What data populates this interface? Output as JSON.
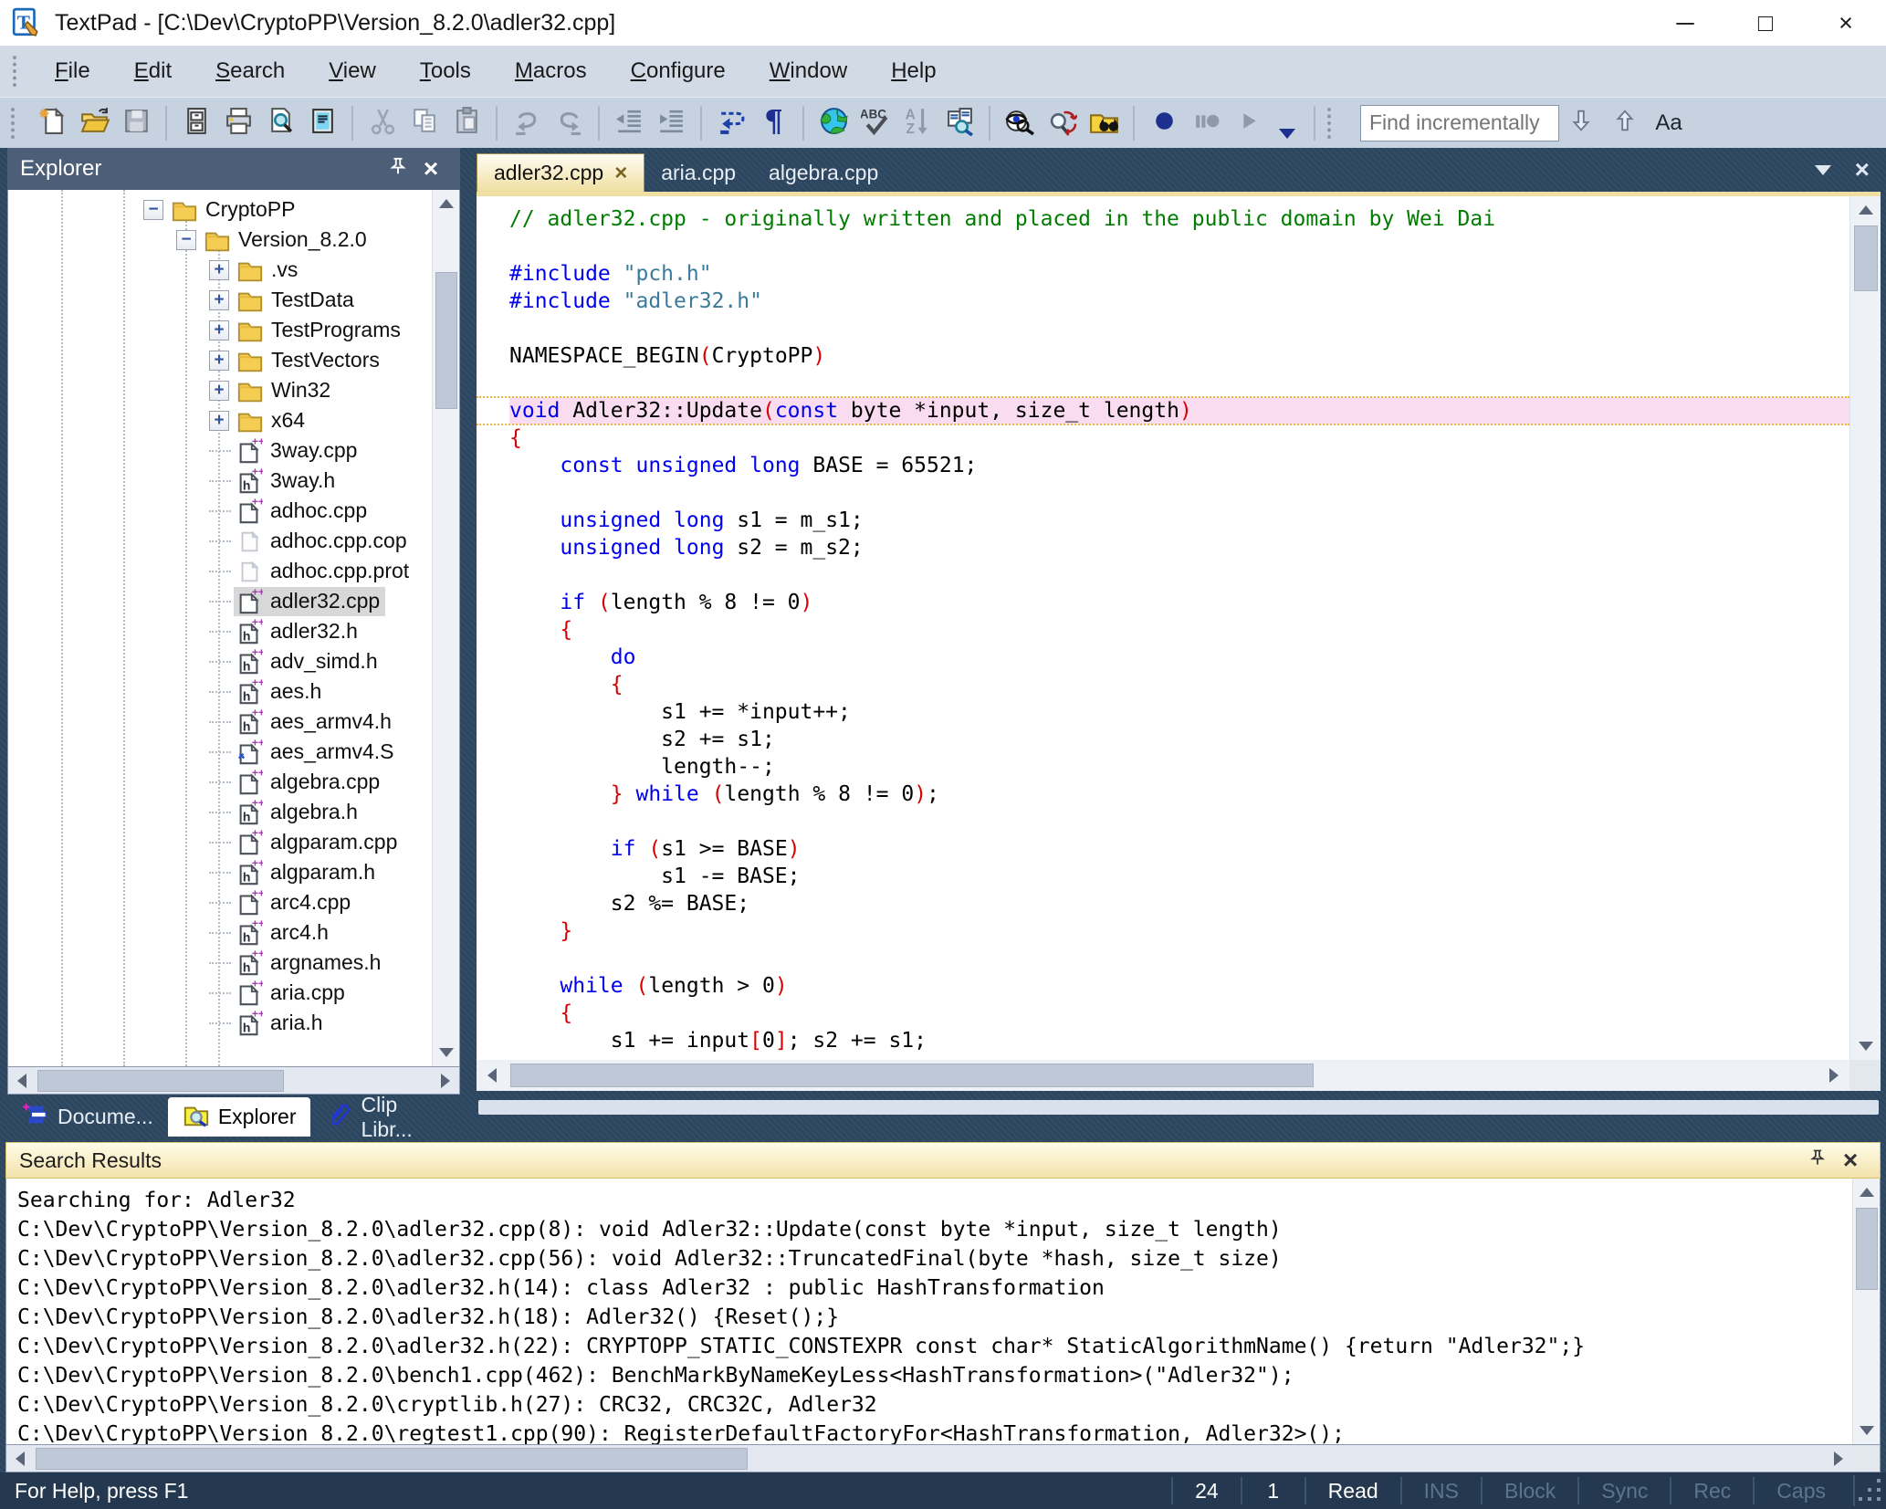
{
  "titlebar": {
    "title": "TextPad - [C:\\Dev\\CryptoPP\\Version_8.2.0\\adler32.cpp]",
    "minimize": "─",
    "maximize": "□",
    "close": "×"
  },
  "menubar": {
    "items": [
      [
        "File",
        0
      ],
      [
        "Edit",
        0
      ],
      [
        "Search",
        0
      ],
      [
        "View",
        0
      ],
      [
        "Tools",
        0
      ],
      [
        "Macros",
        0
      ],
      [
        "Configure",
        0
      ],
      [
        "Window",
        0
      ],
      [
        "Help",
        0
      ]
    ]
  },
  "toolbar": {
    "groups": [
      [
        {
          "icon": "new-document"
        },
        {
          "icon": "open-file"
        },
        {
          "icon": "save",
          "disabled": true
        }
      ],
      [
        {
          "icon": "file-cabinet"
        },
        {
          "icon": "print"
        },
        {
          "icon": "print-preview"
        },
        {
          "icon": "document-properties"
        }
      ],
      [
        {
          "icon": "cut",
          "disabled": true
        },
        {
          "icon": "copy",
          "disabled": true
        },
        {
          "icon": "paste",
          "disabled": true
        }
      ],
      [
        {
          "icon": "undo",
          "disabled": true
        },
        {
          "icon": "redo",
          "disabled": true
        }
      ],
      [
        {
          "icon": "unindent"
        },
        {
          "icon": "indent"
        }
      ],
      [
        {
          "icon": "word-wrap"
        },
        {
          "icon": "show-formatting"
        }
      ],
      [
        {
          "icon": "web-browse"
        },
        {
          "icon": "spell-check"
        },
        {
          "icon": "sort",
          "disabled": true
        },
        {
          "icon": "compare-files"
        }
      ],
      [
        {
          "icon": "document-view"
        },
        {
          "icon": "search-replace"
        },
        {
          "icon": "find-in-files"
        }
      ],
      [
        {
          "icon": "record-macro"
        },
        {
          "icon": "pause-macro",
          "disabled": true
        },
        {
          "icon": "play-macro",
          "disabled": true
        }
      ]
    ],
    "find": {
      "placeholder": "Find incrementally",
      "match_case": "Aa"
    }
  },
  "explorer": {
    "title": "Explorer",
    "tree": [
      {
        "label": "CryptoPP",
        "icon": "folder",
        "expander": "minus",
        "level": 0
      },
      {
        "label": "Version_8.2.0",
        "icon": "folder",
        "expander": "minus",
        "level": 1
      },
      {
        "label": ".vs",
        "icon": "folder",
        "expander": "plus",
        "level": 2
      },
      {
        "label": "TestData",
        "icon": "folder",
        "expander": "plus",
        "level": 2
      },
      {
        "label": "TestPrograms",
        "icon": "folder",
        "expander": "plus",
        "level": 2
      },
      {
        "label": "TestVectors",
        "icon": "folder",
        "expander": "plus",
        "level": 2
      },
      {
        "label": "Win32",
        "icon": "folder",
        "expander": "plus",
        "level": 2
      },
      {
        "label": "x64",
        "icon": "folder",
        "expander": "plus",
        "level": 2
      },
      {
        "label": "3way.cpp",
        "icon": "doc-cpp",
        "level": 2
      },
      {
        "label": "3way.h",
        "icon": "doc-h",
        "level": 2
      },
      {
        "label": "adhoc.cpp",
        "icon": "doc-cpp",
        "level": 2
      },
      {
        "label": "adhoc.cpp.cop",
        "icon": "doc-plain",
        "level": 2
      },
      {
        "label": "adhoc.cpp.prot",
        "icon": "doc-plain",
        "level": 2
      },
      {
        "label": "adler32.cpp",
        "icon": "doc-cpp",
        "level": 2,
        "selected": true
      },
      {
        "label": "adler32.h",
        "icon": "doc-h",
        "level": 2
      },
      {
        "label": "adv_simd.h",
        "icon": "doc-h",
        "level": 2
      },
      {
        "label": "aes.h",
        "icon": "doc-h",
        "level": 2
      },
      {
        "label": "aes_armv4.h",
        "icon": "doc-h",
        "level": 2
      },
      {
        "label": "aes_armv4.S",
        "icon": "doc-asm",
        "level": 2
      },
      {
        "label": "algebra.cpp",
        "icon": "doc-cpp",
        "level": 2
      },
      {
        "label": "algebra.h",
        "icon": "doc-h",
        "level": 2
      },
      {
        "label": "algparam.cpp",
        "icon": "doc-cpp",
        "level": 2
      },
      {
        "label": "algparam.h",
        "icon": "doc-h",
        "level": 2
      },
      {
        "label": "arc4.cpp",
        "icon": "doc-cpp",
        "level": 2
      },
      {
        "label": "arc4.h",
        "icon": "doc-h",
        "level": 2
      },
      {
        "label": "argnames.h",
        "icon": "doc-h",
        "level": 2
      },
      {
        "label": "aria.cpp",
        "icon": "doc-cpp",
        "level": 2
      },
      {
        "label": "aria.h",
        "icon": "doc-h",
        "level": 2
      }
    ]
  },
  "tabs": {
    "documents": [
      {
        "label": "adler32.cpp",
        "active": true,
        "close": "×"
      },
      {
        "label": "aria.cpp"
      },
      {
        "label": "algebra.cpp"
      }
    ]
  },
  "editor": {
    "lines": [
      {
        "t": [
          [
            "c",
            "// adler32.cpp - originally written and placed in the public domain by Wei Dai"
          ]
        ]
      },
      {
        "t": []
      },
      {
        "t": [
          [
            "k",
            "#include"
          ],
          [
            "n",
            " "
          ],
          [
            "s",
            "\"pch.h\""
          ]
        ]
      },
      {
        "t": [
          [
            "k",
            "#include"
          ],
          [
            "n",
            " "
          ],
          [
            "s",
            "\"adler32.h\""
          ]
        ]
      },
      {
        "t": []
      },
      {
        "t": [
          [
            "n",
            "NAMESPACE_BEGIN"
          ],
          [
            "p",
            "("
          ],
          [
            "n",
            "CryptoPP"
          ],
          [
            "p",
            ")"
          ]
        ]
      },
      {
        "t": []
      },
      {
        "hl": true,
        "t": [
          [
            "k",
            "void"
          ],
          [
            "n",
            " Adler32::Update"
          ],
          [
            "p",
            "("
          ],
          [
            "k",
            "const"
          ],
          [
            "n",
            " byte *input, size_t length"
          ],
          [
            "p",
            ")"
          ]
        ]
      },
      {
        "t": [
          [
            "p",
            "{"
          ]
        ]
      },
      {
        "t": [
          [
            "n",
            "    "
          ],
          [
            "k",
            "const"
          ],
          [
            "n",
            " "
          ],
          [
            "k",
            "unsigned"
          ],
          [
            "n",
            " "
          ],
          [
            "k",
            "long"
          ],
          [
            "n",
            " BASE = 65521;"
          ]
        ]
      },
      {
        "t": []
      },
      {
        "t": [
          [
            "n",
            "    "
          ],
          [
            "k",
            "unsigned"
          ],
          [
            "n",
            " "
          ],
          [
            "k",
            "long"
          ],
          [
            "n",
            " s1 = m_s1;"
          ]
        ]
      },
      {
        "t": [
          [
            "n",
            "    "
          ],
          [
            "k",
            "unsigned"
          ],
          [
            "n",
            " "
          ],
          [
            "k",
            "long"
          ],
          [
            "n",
            " s2 = m_s2;"
          ]
        ]
      },
      {
        "t": []
      },
      {
        "t": [
          [
            "n",
            "    "
          ],
          [
            "k",
            "if"
          ],
          [
            "n",
            " "
          ],
          [
            "p",
            "("
          ],
          [
            "n",
            "length % 8 != 0"
          ],
          [
            "p",
            ")"
          ]
        ]
      },
      {
        "t": [
          [
            "n",
            "    "
          ],
          [
            "p",
            "{"
          ]
        ]
      },
      {
        "t": [
          [
            "n",
            "        "
          ],
          [
            "k",
            "do"
          ]
        ]
      },
      {
        "t": [
          [
            "n",
            "        "
          ],
          [
            "p",
            "{"
          ]
        ]
      },
      {
        "t": [
          [
            "n",
            "            s1 += *input++;"
          ]
        ]
      },
      {
        "t": [
          [
            "n",
            "            s2 += s1;"
          ]
        ]
      },
      {
        "t": [
          [
            "n",
            "            length--;"
          ]
        ]
      },
      {
        "t": [
          [
            "n",
            "        "
          ],
          [
            "p",
            "}"
          ],
          [
            "n",
            " "
          ],
          [
            "k",
            "while"
          ],
          [
            "n",
            " "
          ],
          [
            "p",
            "("
          ],
          [
            "n",
            "length % 8 != 0"
          ],
          [
            "p",
            ")"
          ],
          [
            "n",
            ";"
          ]
        ]
      },
      {
        "t": []
      },
      {
        "t": [
          [
            "n",
            "        "
          ],
          [
            "k",
            "if"
          ],
          [
            "n",
            " "
          ],
          [
            "p",
            "("
          ],
          [
            "n",
            "s1 >= BASE"
          ],
          [
            "p",
            ")"
          ]
        ]
      },
      {
        "t": [
          [
            "n",
            "            s1 -= BASE;"
          ]
        ]
      },
      {
        "t": [
          [
            "n",
            "        s2 %= BASE;"
          ]
        ]
      },
      {
        "t": [
          [
            "n",
            "    "
          ],
          [
            "p",
            "}"
          ]
        ]
      },
      {
        "t": []
      },
      {
        "t": [
          [
            "n",
            "    "
          ],
          [
            "k",
            "while"
          ],
          [
            "n",
            " "
          ],
          [
            "p",
            "("
          ],
          [
            "n",
            "length > 0"
          ],
          [
            "p",
            ")"
          ]
        ]
      },
      {
        "t": [
          [
            "n",
            "    "
          ],
          [
            "p",
            "{"
          ]
        ]
      },
      {
        "t": [
          [
            "n",
            "        s1 += input"
          ],
          [
            "p",
            "["
          ],
          [
            "n",
            "0"
          ],
          [
            "p",
            "]"
          ],
          [
            "n",
            "; s2 += s1;"
          ]
        ]
      }
    ]
  },
  "panel_tabs": [
    {
      "label": "Docume...",
      "icon": "documents-stack"
    },
    {
      "label": "Explorer",
      "icon": "folder-search",
      "active": true
    },
    {
      "label": "Clip Libr...",
      "icon": "paperclip"
    }
  ],
  "search_results": {
    "title": "Search Results",
    "lines": [
      "Searching for: Adler32",
      "C:\\Dev\\CryptoPP\\Version_8.2.0\\adler32.cpp(8): void Adler32::Update(const byte *input, size_t length)",
      "C:\\Dev\\CryptoPP\\Version_8.2.0\\adler32.cpp(56): void Adler32::TruncatedFinal(byte *hash, size_t size)",
      "C:\\Dev\\CryptoPP\\Version_8.2.0\\adler32.h(14): class Adler32 : public HashTransformation",
      "C:\\Dev\\CryptoPP\\Version_8.2.0\\adler32.h(18): Adler32() {Reset();}",
      "C:\\Dev\\CryptoPP\\Version_8.2.0\\adler32.h(22): CRYPTOPP_STATIC_CONSTEXPR const char* StaticAlgorithmName() {return \"Adler32\";}",
      "C:\\Dev\\CryptoPP\\Version_8.2.0\\bench1.cpp(462): BenchMarkByNameKeyLess<HashTransformation>(\"Adler32\");",
      "C:\\Dev\\CryptoPP\\Version_8.2.0\\cryptlib.h(27): CRC32, CRC32C, Adler32",
      "C:\\Dev\\CryptoPP\\Version_8.2.0\\regtest1.cpp(90): RegisterDefaultFactoryFor<HashTransformation, Adler32>();"
    ]
  },
  "statusbar": {
    "help": "For Help, press F1",
    "panes": [
      [
        "24",
        true
      ],
      [
        "1",
        true
      ],
      [
        "Read",
        true
      ],
      [
        "INS",
        false
      ],
      [
        "Block",
        false
      ],
      [
        "Sync",
        false
      ],
      [
        "Rec",
        false
      ],
      [
        "Caps",
        false
      ]
    ]
  }
}
